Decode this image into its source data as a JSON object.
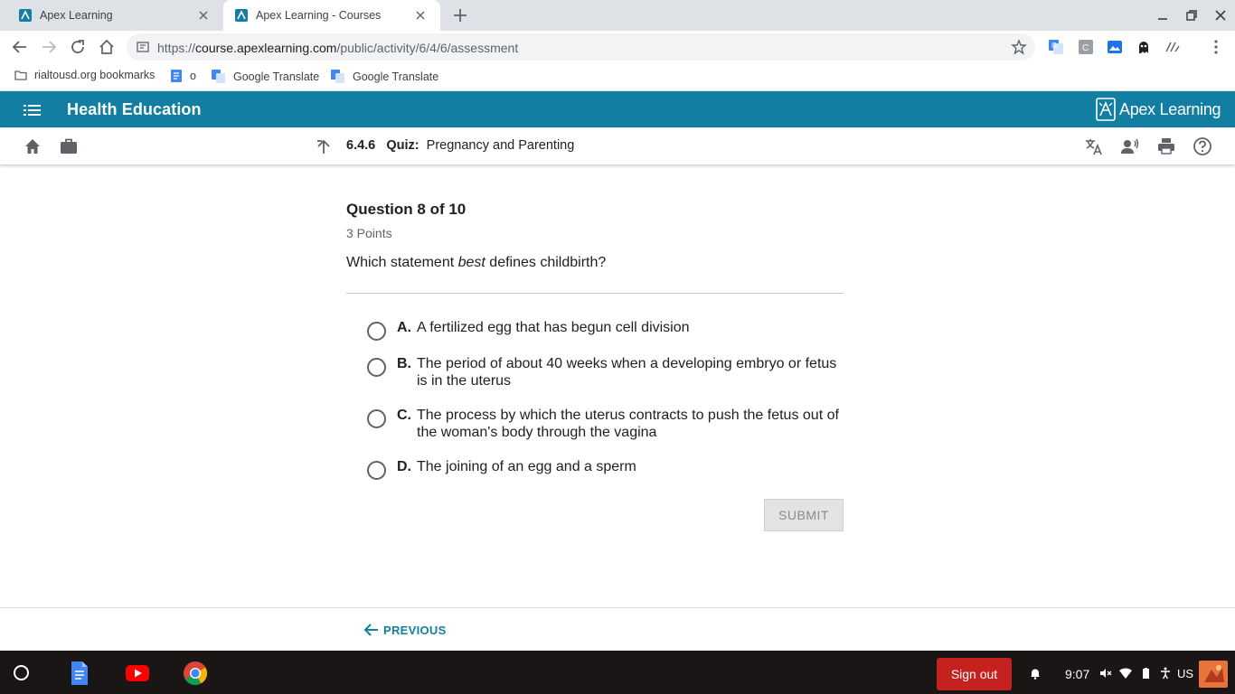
{
  "browser": {
    "tabs": [
      {
        "title": "Apex Learning",
        "active": false
      },
      {
        "title": "Apex Learning - Courses",
        "active": true
      }
    ],
    "url": {
      "prefix": "https://",
      "host": "course.apexlearning.com",
      "path": "/public/activity/6/4/6/assessment"
    },
    "bookmarks": [
      {
        "label": "rialtousd.org bookmarks",
        "icon": "folder-icon"
      },
      {
        "label": "o",
        "icon": "docs-icon"
      },
      {
        "label": "Google Translate",
        "icon": "google-translate-icon"
      },
      {
        "label": "Google Translate",
        "icon": "google-translate-icon"
      }
    ]
  },
  "app": {
    "course_title": "Health Education",
    "logo_text": "Apex Learning",
    "brand_color": "#127ea1",
    "activity": {
      "number": "6.4.6",
      "type": "Quiz:",
      "name": "Pregnancy and Parenting"
    }
  },
  "question": {
    "header": "Question 8 of 10",
    "points": "3 Points",
    "prompt_before": "Which statement ",
    "prompt_emph": "best",
    "prompt_after": " defines childbirth?",
    "options": [
      {
        "letter": "A.",
        "text": "A fertilized egg that has begun cell division"
      },
      {
        "letter": "B.",
        "text": "The period of about 40 weeks when a developing embryo or fetus is in the uterus"
      },
      {
        "letter": "C.",
        "text": "The process by which the uterus contracts to push the fetus out of the woman's body through the vagina"
      },
      {
        "letter": "D.",
        "text": "The joining of an egg and a sperm"
      }
    ],
    "submit_label": "SUBMIT"
  },
  "footer": {
    "previous_label": "PREVIOUS"
  },
  "shelf": {
    "sign_out_label": "Sign out",
    "time": "9:07",
    "locale": "US",
    "sign_out_color": "#c5221f"
  }
}
